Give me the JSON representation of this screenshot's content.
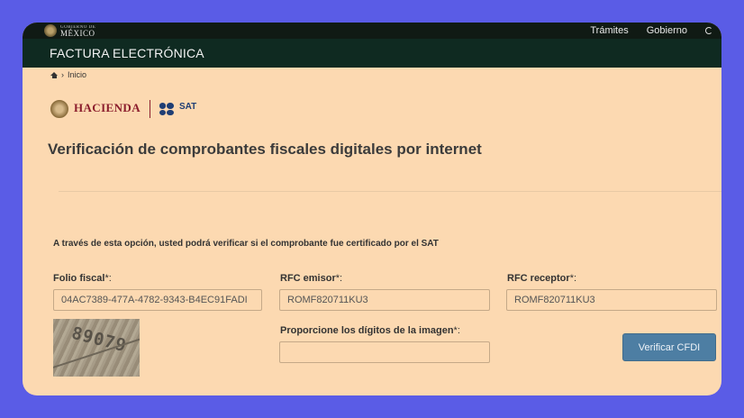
{
  "gov_bar": {
    "logo_top": "GOBIERNO DE",
    "logo_main": "MÉXICO",
    "nav": [
      "Trámites",
      "Gobierno"
    ]
  },
  "site_title": "FACTURA ELECTRÓNICA",
  "breadcrumb": {
    "home": "Inicio"
  },
  "logos": {
    "hacienda": "HACIENDA",
    "sat": "SAT"
  },
  "page_title": "Verificación de comprobantes fiscales digitales por internet",
  "intro": "A través de esta opción, usted podrá verificar si el comprobante fue certificado por el SAT",
  "form": {
    "folio_label": "Folio fiscal",
    "folio_value": "04AC7389-477A-4782-9343-B4EC91FADI",
    "rfc_emisor_label": "RFC emisor",
    "rfc_emisor_value": "ROMF820711KU3",
    "rfc_receptor_label": "RFC receptor",
    "rfc_receptor_value": "ROMF820711KU3",
    "captcha_label": "Proporcione los dígitos de la imagen",
    "captcha_value": "",
    "captcha_image_text": "89079",
    "required_mark": "*:",
    "verify_button": "Verificar CFDI"
  },
  "colors": {
    "page_bg": "#fcd9b1",
    "header_dark": "#0f2a21",
    "outer_bg": "#5a5ce6",
    "button": "#4d7ea3",
    "hacienda": "#8b1d2c",
    "sat": "#1f3e74"
  }
}
